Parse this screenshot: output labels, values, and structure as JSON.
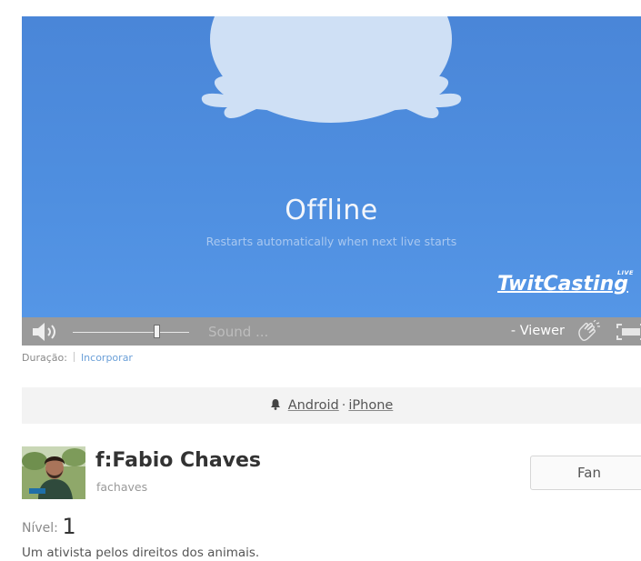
{
  "player": {
    "status_title": "Offline",
    "status_subtitle": "Restarts automatically when next live starts",
    "brand_name": "TwitCasting",
    "brand_badge": "LIVE",
    "background_color": "#4f8fe0"
  },
  "controls": {
    "volume_level": 0.72,
    "sound_label": "Sound ...",
    "viewer_label": "- Viewer",
    "icons": [
      "speaker-icon",
      "clap-icon",
      "fullscreen-icon"
    ]
  },
  "meta": {
    "duration_label": "Duração:",
    "embed_link": "Incorporar"
  },
  "apps": {
    "android_label": "Android",
    "separator": "·",
    "iphone_label": "iPhone"
  },
  "profile": {
    "display_name": "f:Fabio Chaves",
    "handle": "fachaves",
    "fan_button": "Fan",
    "level_label": "Nível:",
    "level_value": "1",
    "bio": "Um ativista pelos direitos dos animais."
  }
}
